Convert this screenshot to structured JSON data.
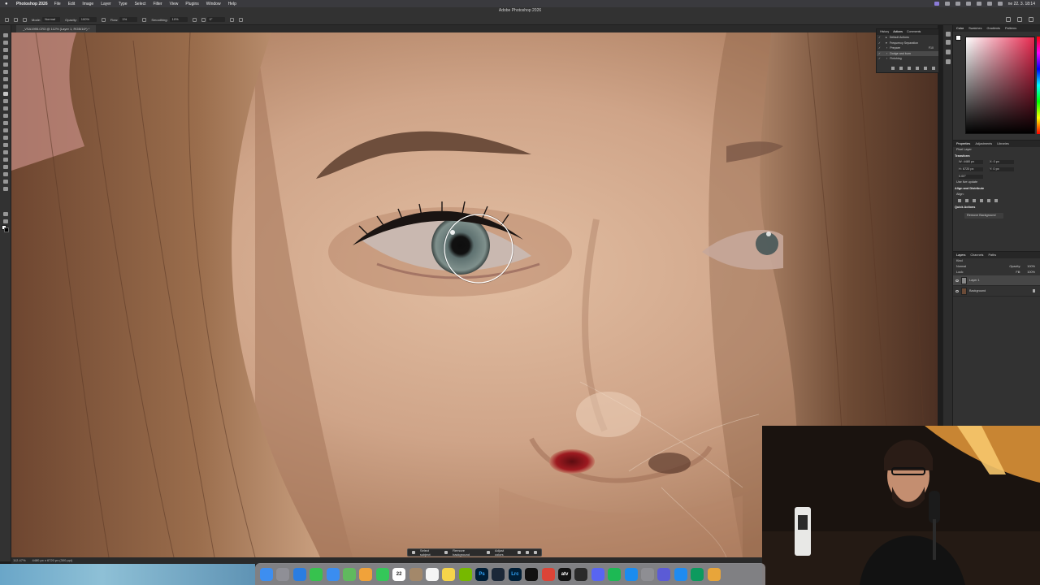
{
  "menubar": {
    "app_name": "Photoshop 2026",
    "items": [
      "File",
      "Edit",
      "Image",
      "Layer",
      "Type",
      "Select",
      "Filter",
      "View",
      "Plugins",
      "Window",
      "Help"
    ],
    "clock": "ne 22. 3.  18:14"
  },
  "window_title": "Adobe Photoshop 2026",
  "options_bar": {
    "mode_label": "Mode:",
    "mode_value": "Normal",
    "opacity_label": "Opacity:",
    "opacity_value": "100%",
    "flow_label": "Flow:",
    "flow_value": "1%",
    "smoothing_label": "Smoothing:",
    "smoothing_value": "10%",
    "angle_value": "0°"
  },
  "document_tab": "_VSA1995.CR3 @ 112% (Layer 1, RGB/16*) *",
  "status": {
    "zoom": "112.47%",
    "doc_info": "4480 px x 6720 px (300 ppi)"
  },
  "context_bar": {
    "select_subject": "Select subject",
    "remove_background": "Remove background",
    "adjust_colors": "Adjust colors"
  },
  "actions_panel": {
    "tabs": [
      "History",
      "Actions",
      "Comments"
    ],
    "active_tab": "Actions",
    "rows": [
      {
        "label": "Default Actions",
        "checked": true
      },
      {
        "label": "Frequency Separation",
        "checked": true
      },
      {
        "label": "Prepare",
        "checked": true,
        "shortcut": "F10"
      },
      {
        "label": "Dodge and burn",
        "checked": true,
        "selected": true
      },
      {
        "label": "Finishing",
        "checked": true
      }
    ]
  },
  "color_panel": {
    "tabs": [
      "Color",
      "Swatches",
      "Gradients",
      "Patterns"
    ],
    "active_tab": "Color",
    "hue_color": "#e8294f"
  },
  "properties_panel": {
    "tabs": [
      "Properties",
      "Adjustments",
      "Libraries"
    ],
    "active_tab": "Properties",
    "layer_kind": "Pixel Layer",
    "transform_label": "Transform",
    "w": "W: 4480 px",
    "h": "H: 6720 px",
    "x": "X: 0 px",
    "y": "Y: 0 px",
    "angle": "0.00°",
    "live_update": "Use live update",
    "align_label": "Align and Distribute",
    "align_sub": "Align:",
    "quick_actions": "Quick Actions",
    "remove_bg_btn": "Remove Background"
  },
  "layers_panel": {
    "tabs": [
      "Layers",
      "Channels",
      "Paths"
    ],
    "active_tab": "Layers",
    "kind_label": "Kind",
    "blend": "Normal",
    "opacity_label": "Opacity:",
    "opacity": "100%",
    "lock_label": "Lock:",
    "fill_label": "Fill:",
    "fill": "100%",
    "layers": [
      {
        "name": "Layer 1",
        "selected": true
      },
      {
        "name": "Background",
        "locked": true
      }
    ]
  },
  "dock_apps": [
    "finder-icon",
    "launchpad-icon",
    "safari-icon",
    "messages-icon",
    "mail-icon",
    "maps-icon",
    "photos-icon",
    "facetime-icon",
    "calendar-icon",
    "contacts-icon",
    "reminders-icon",
    "notes-icon",
    "nvidia-icon",
    "photoshop-icon",
    "steam-icon",
    "lightroom-classic-icon",
    "chatgpt-icon",
    "chrome-icon",
    "appletv-icon",
    "epic-icon",
    "discord-icon",
    "spotify-icon",
    "appstore-icon",
    "settings-icon",
    "grid-icon",
    "xcode-icon",
    "edge-icon",
    "folder-icon"
  ],
  "calendar_day": "22",
  "dock_labels": {
    "photoshop": "Ps",
    "lightroom": "Lrc",
    "appletv": "atv"
  }
}
